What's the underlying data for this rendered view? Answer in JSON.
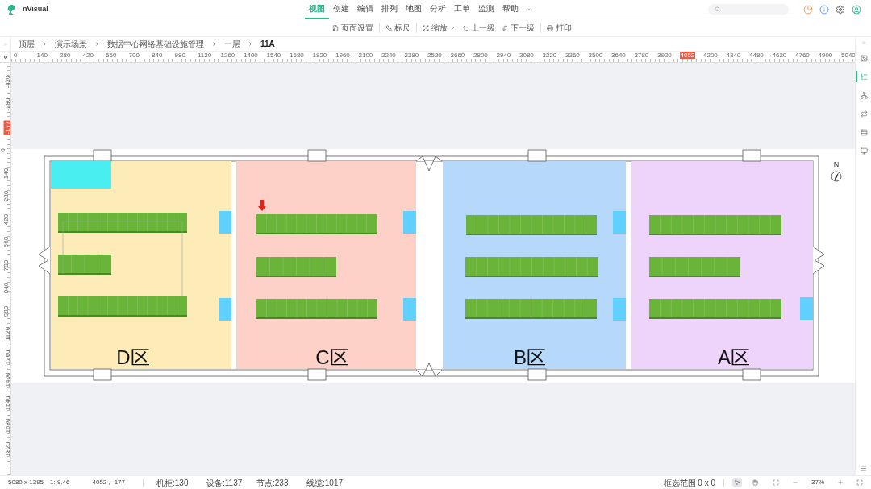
{
  "app": {
    "name": "nVisual"
  },
  "menu": [
    {
      "label": "视图",
      "selected": true
    },
    {
      "label": "创建",
      "selected": false
    },
    {
      "label": "编辑",
      "selected": false
    },
    {
      "label": "排列",
      "selected": false
    },
    {
      "label": "地图",
      "selected": false
    },
    {
      "label": "分析",
      "selected": false
    },
    {
      "label": "工单",
      "selected": false
    },
    {
      "label": "监测",
      "selected": false
    },
    {
      "label": "帮助",
      "selected": false
    }
  ],
  "toolbar": [
    {
      "label": "页面设置",
      "kind": "page"
    },
    {
      "label": "标尺",
      "kind": "ruler"
    },
    {
      "label": "缩放",
      "kind": "zoom"
    },
    {
      "label": "上一级",
      "kind": "up"
    },
    {
      "label": "下一级",
      "kind": "down"
    },
    {
      "label": "打印",
      "kind": "print"
    }
  ],
  "breadcrumb": [
    {
      "label": "顶层",
      "selected": false
    },
    {
      "label": "演示场景",
      "selected": false
    },
    {
      "label": "数据中心网络基础设施管理",
      "selected": false
    },
    {
      "label": "一层",
      "selected": false
    },
    {
      "label": "11A",
      "selected": true
    }
  ],
  "ruler_x": [
    {
      "label": "0",
      "selected": false
    },
    {
      "label": "140",
      "selected": false
    },
    {
      "label": "280",
      "selected": false
    },
    {
      "label": "420",
      "selected": false
    },
    {
      "label": "560",
      "selected": false
    },
    {
      "label": "700",
      "selected": false
    },
    {
      "label": "840",
      "selected": false
    },
    {
      "label": "980",
      "selected": false
    },
    {
      "label": "1120",
      "selected": false
    },
    {
      "label": "1260",
      "selected": false
    },
    {
      "label": "1400",
      "selected": false
    },
    {
      "label": "1540",
      "selected": false
    },
    {
      "label": "1680",
      "selected": false
    },
    {
      "label": "1820",
      "selected": false
    },
    {
      "label": "1960",
      "selected": false
    },
    {
      "label": "2100",
      "selected": false
    },
    {
      "label": "2240",
      "selected": false
    },
    {
      "label": "2380",
      "selected": false
    },
    {
      "label": "2520",
      "selected": false
    },
    {
      "label": "2660",
      "selected": false
    },
    {
      "label": "2800",
      "selected": false
    },
    {
      "label": "2940",
      "selected": false
    },
    {
      "label": "3080",
      "selected": false
    },
    {
      "label": "3220",
      "selected": false
    },
    {
      "label": "3360",
      "selected": false
    },
    {
      "label": "3500",
      "selected": false
    },
    {
      "label": "3640",
      "selected": false
    },
    {
      "label": "3780",
      "selected": false
    },
    {
      "label": "3920",
      "selected": false
    },
    {
      "label": "4052",
      "selected": true
    },
    {
      "label": "4200",
      "selected": false
    },
    {
      "label": "4340",
      "selected": false
    },
    {
      "label": "4480",
      "selected": false
    },
    {
      "label": "4620",
      "selected": false
    },
    {
      "label": "4760",
      "selected": false
    },
    {
      "label": "4900",
      "selected": false
    },
    {
      "label": "5040",
      "selected": false
    }
  ],
  "ruler_y": [
    {
      "label": "-420",
      "selected": false
    },
    {
      "label": "-280",
      "selected": false
    },
    {
      "label": "-177",
      "selected": true
    },
    {
      "label": "0",
      "selected": false
    },
    {
      "label": "140",
      "selected": false
    },
    {
      "label": "280",
      "selected": false
    },
    {
      "label": "420",
      "selected": false
    },
    {
      "label": "560",
      "selected": false
    },
    {
      "label": "700",
      "selected": false
    },
    {
      "label": "840",
      "selected": false
    },
    {
      "label": "980",
      "selected": false
    },
    {
      "label": "1120",
      "selected": false
    },
    {
      "label": "1260",
      "selected": false
    },
    {
      "label": "1400",
      "selected": false
    },
    {
      "label": "1540",
      "selected": false
    },
    {
      "label": "1680",
      "selected": false
    },
    {
      "label": "1820",
      "selected": false
    }
  ],
  "floor": {
    "compass": "N",
    "zones": [
      {
        "label": "D区",
        "color": "#fdecb8"
      },
      {
        "label": "C区",
        "color": "#fdd0c8"
      },
      {
        "label": "B区",
        "color": "#b5d8fb"
      },
      {
        "label": "A区",
        "color": "#eed3fb"
      }
    ]
  },
  "status_bar": {
    "left": [
      "5080 x 1395",
      "1: 9.46",
      "4052 , -177"
    ],
    "counts": [
      "机柜:130",
      "设备:1137",
      "节点:233",
      "线缆:1017"
    ],
    "selection": "框选范围 0 x 0",
    "zoom": "37%"
  },
  "tools": [
    {
      "kind": "pointer",
      "selected": true
    },
    {
      "kind": "hand",
      "selected": false
    }
  ],
  "side_panel": [
    {
      "kind": "image",
      "selected": false
    },
    {
      "kind": "list",
      "selected": true
    },
    {
      "kind": "nodes",
      "selected": false
    },
    {
      "kind": "swap",
      "selected": false
    },
    {
      "kind": "stack",
      "selected": false
    },
    {
      "kind": "monitor",
      "selected": false
    }
  ]
}
